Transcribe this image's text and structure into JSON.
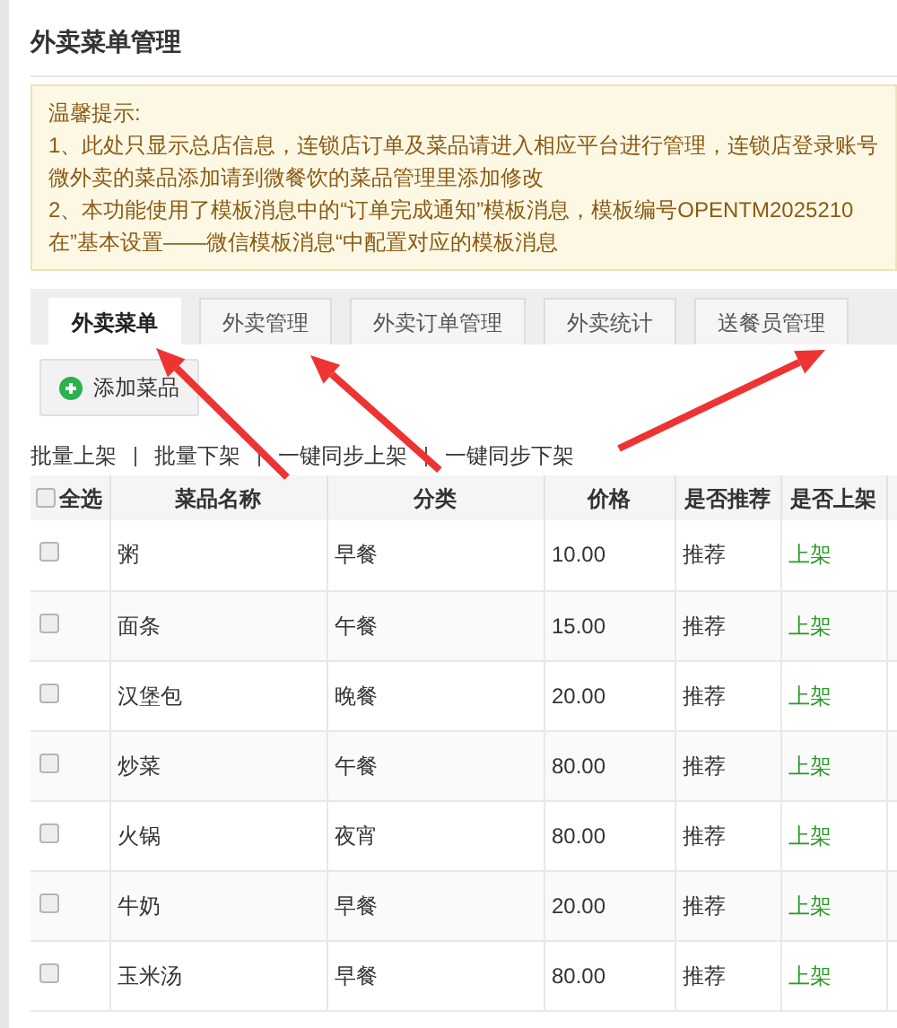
{
  "page_title": "外卖菜单管理",
  "notice": {
    "heading": "温馨提示:",
    "lines": [
      "1、此处只显示总店信息，连锁店订单及菜品请进入相应平台进行管理，连锁店登录账号",
      "微外卖的菜品添加请到微餐饮的菜品管理里添加修改",
      "2、本功能使用了模板消息中的“订单完成通知”模板消息，模板编号OPENTM2025210",
      "在”基本设置——微信模板消息“中配置对应的模板消息"
    ]
  },
  "tabs": [
    {
      "label": "外卖菜单",
      "selected": true
    },
    {
      "label": "外卖管理",
      "selected": false
    },
    {
      "label": "外卖订单管理",
      "selected": false
    },
    {
      "label": "外卖统计",
      "selected": false
    },
    {
      "label": "送餐员管理",
      "selected": false
    }
  ],
  "add_button": "添加菜品",
  "bulk_actions": [
    "批量上架",
    "批量下架",
    "一键同步上架",
    "一键同步下架"
  ],
  "table": {
    "select_all_checked": false,
    "columns": [
      "全选",
      "菜品名称",
      "分类",
      "价格",
      "是否推荐",
      "是否上架"
    ],
    "rows": [
      {
        "checked": false,
        "name": "粥",
        "category": "早餐",
        "price": "10.00",
        "recommend": "推荐",
        "status": "上架"
      },
      {
        "checked": false,
        "name": "面条",
        "category": "午餐",
        "price": "15.00",
        "recommend": "推荐",
        "status": "上架"
      },
      {
        "checked": false,
        "name": "汉堡包",
        "category": "晚餐",
        "price": "20.00",
        "recommend": "推荐",
        "status": "上架"
      },
      {
        "checked": false,
        "name": "炒菜",
        "category": "午餐",
        "price": "80.00",
        "recommend": "推荐",
        "status": "上架"
      },
      {
        "checked": false,
        "name": "火锅",
        "category": "夜宵",
        "price": "80.00",
        "recommend": "推荐",
        "status": "上架"
      },
      {
        "checked": false,
        "name": "牛奶",
        "category": "早餐",
        "price": "20.00",
        "recommend": "推荐",
        "status": "上架"
      },
      {
        "checked": false,
        "name": "玉米汤",
        "category": "早餐",
        "price": "80.00",
        "recommend": "推荐",
        "status": "上架"
      }
    ]
  }
}
